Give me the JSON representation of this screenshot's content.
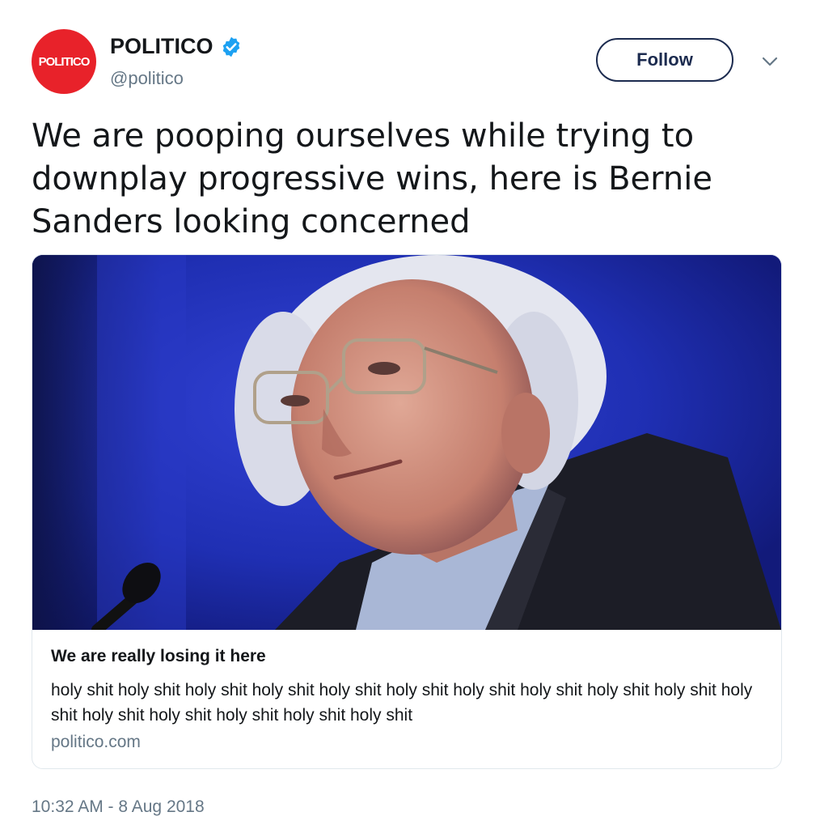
{
  "tweet": {
    "author": {
      "avatar_text": "POLITICO",
      "display_name": "POLITICO",
      "handle": "@politico",
      "verified": true
    },
    "follow_label": "Follow",
    "text": "We are pooping ourselves while trying to downplay progressive wins, here is Bernie Sanders looking concerned",
    "card": {
      "title": "We are really losing it here",
      "description": "holy shit holy shit holy shit holy shit holy shit holy shit holy shit holy shit holy shit holy shit holy shit holy shit holy shit holy shit holy shit holy shit",
      "domain": "politico.com"
    },
    "timestamp": "10:32 AM - 8 Aug 2018"
  },
  "colors": {
    "brand_red": "#e8222a",
    "verified_blue": "#1da1f2",
    "follow_border": "#1c2b4f",
    "secondary_text": "#657786",
    "image_background": "#1d2aa8"
  },
  "icons": {
    "verified": "verified-badge-icon",
    "caret": "chevron-down-icon"
  }
}
